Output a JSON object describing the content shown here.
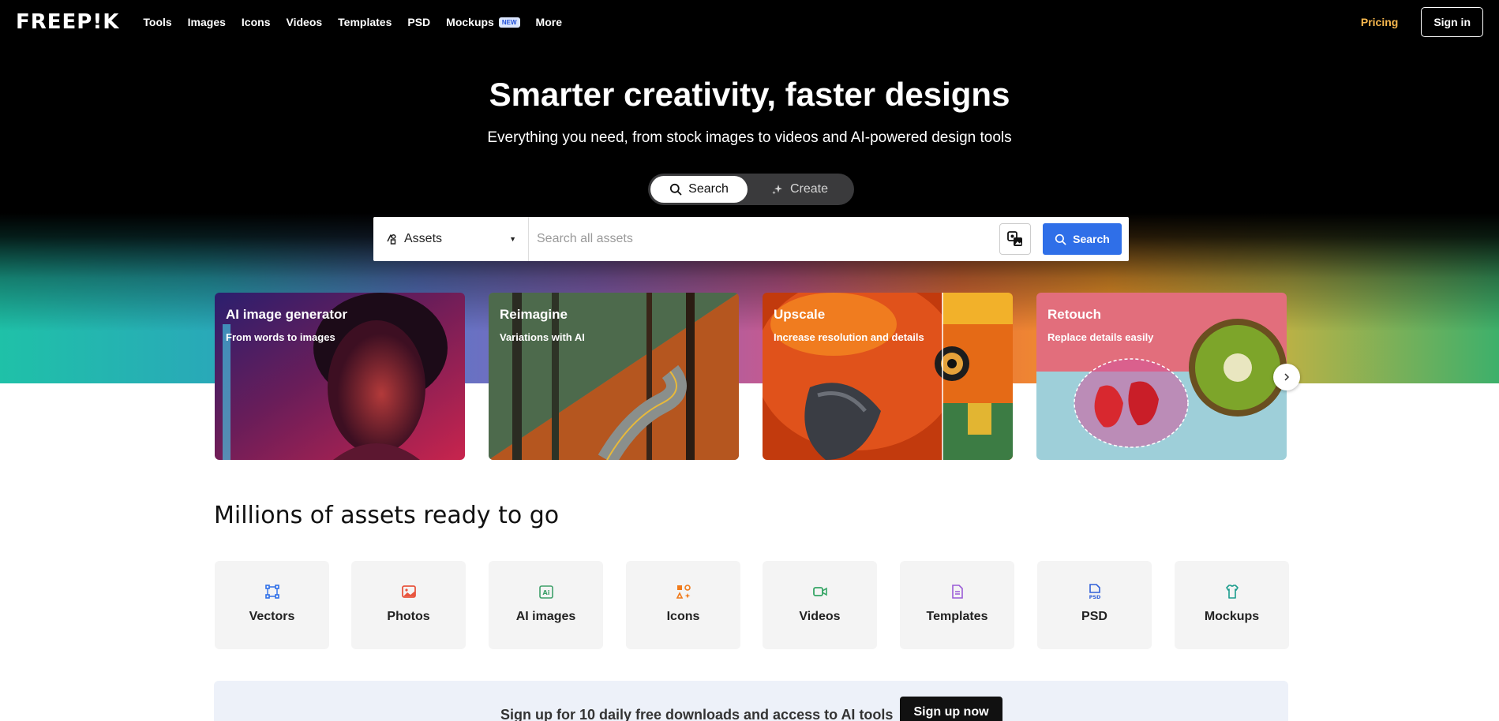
{
  "header": {
    "logo": "FREEP!K",
    "nav": [
      {
        "label": "Tools"
      },
      {
        "label": "Images"
      },
      {
        "label": "Icons"
      },
      {
        "label": "Videos"
      },
      {
        "label": "Templates"
      },
      {
        "label": "PSD"
      },
      {
        "label": "Mockups",
        "badge": "NEW"
      },
      {
        "label": "More"
      }
    ],
    "pricing": "Pricing",
    "signin": "Sign in"
  },
  "hero": {
    "title": "Smarter creativity, faster designs",
    "subtitle": "Everything you need, from stock images to videos and AI-powered design tools",
    "modes": [
      {
        "label": "Search",
        "icon": "search-icon",
        "active": true
      },
      {
        "label": "Create",
        "icon": "sparkle-icon",
        "active": false
      }
    ]
  },
  "search": {
    "category": "Assets",
    "placeholder": "Search all assets",
    "value": "",
    "button": "Search"
  },
  "features": [
    {
      "title": "AI image generator",
      "subtitle": "From words to images"
    },
    {
      "title": "Reimagine",
      "subtitle": "Variations with AI"
    },
    {
      "title": "Upscale",
      "subtitle": "Increase resolution and details"
    },
    {
      "title": "Retouch",
      "subtitle": "Replace details easily"
    }
  ],
  "assets": {
    "title": "Millions of assets ready to go",
    "categories": [
      {
        "label": "Vectors",
        "icon": "vector-icon",
        "color": "#2f6fe8"
      },
      {
        "label": "Photos",
        "icon": "photo-icon",
        "color": "#e8553e"
      },
      {
        "label": "AI images",
        "icon": "ai-image-icon",
        "color": "#3fa06a"
      },
      {
        "label": "Icons",
        "icon": "icons-icon",
        "color": "#f07a1a"
      },
      {
        "label": "Videos",
        "icon": "video-icon",
        "color": "#35a565"
      },
      {
        "label": "Templates",
        "icon": "template-icon",
        "color": "#9a5bd6"
      },
      {
        "label": "PSD",
        "icon": "psd-icon",
        "color": "#2f5fd8"
      },
      {
        "label": "Mockups",
        "icon": "mockup-icon",
        "color": "#1c9d8d"
      }
    ]
  },
  "banner": {
    "text": "Sign up for 10 daily free downloads and access to AI tools",
    "button": "Sign up now"
  },
  "colors": {
    "accent": "#2f6fe8",
    "pricing": "#f8b84e",
    "hero_bg": "#000000"
  }
}
